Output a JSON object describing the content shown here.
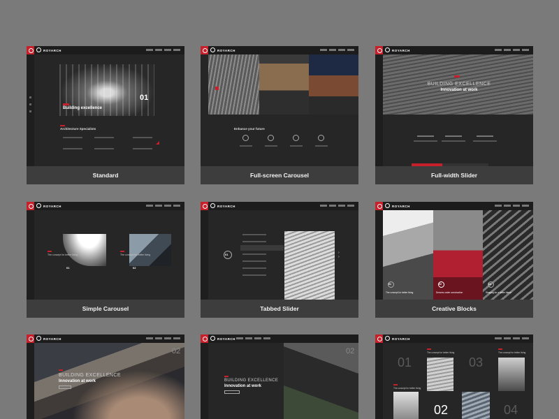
{
  "brand": "ROYARCH",
  "cards": [
    {
      "label": "Standard",
      "hero_title": "Building excellence",
      "section_title": "Architecture Specialists",
      "slide_num": "01"
    },
    {
      "label": "Full-screen Carousel",
      "section_title": "Enhance your future"
    },
    {
      "label": "Full-width Slider",
      "hero_line1": "BUILDING EXCELLENCE",
      "hero_line2": "Innovation at work"
    },
    {
      "label": "Simple Carousel",
      "item_text_1": "The concept for better living",
      "item_text_2": "The concept for better living",
      "n1": "01",
      "n2": "02"
    },
    {
      "label": "Tabbed Slider",
      "num": "01"
    },
    {
      "label": "Creative Blocks",
      "b1_text": "The concept for better living",
      "b2_text": "Dreams under construction",
      "b3_text": "Shaping for a better future",
      "n1": "01",
      "n2": "02",
      "n3": "03"
    },
    {
      "label": "",
      "hero_line1": "BUILDING EXCELLENCE",
      "hero_line2": "Innovation at work",
      "num": "02"
    },
    {
      "label": "",
      "hero_line1": "BUILDING EXCELLENCE",
      "hero_line2": "Innovation at work",
      "num": "02"
    },
    {
      "label": "",
      "n1": "01",
      "n2": "02",
      "n3": "03",
      "n4": "04",
      "t1": "The concept for better living",
      "t2": "The concept for better living",
      "t3": "The concept for better living"
    }
  ],
  "colors": {
    "accent": "#c8202b",
    "background": "#7a7a7a",
    "card": "#262626",
    "label_bar": "#3d3d3d"
  }
}
